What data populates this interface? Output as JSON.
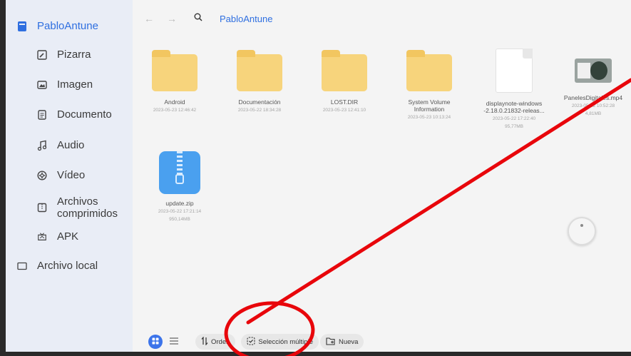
{
  "sidebar": {
    "root": {
      "label": "PabloAntune",
      "icon": "phone-icon"
    },
    "items": [
      {
        "label": "Pizarra",
        "icon": "whiteboard-icon"
      },
      {
        "label": "Imagen",
        "icon": "image-icon"
      },
      {
        "label": "Documento",
        "icon": "document-icon"
      },
      {
        "label": "Audio",
        "icon": "music-note-icon"
      },
      {
        "label": "Vídeo",
        "icon": "video-icon"
      },
      {
        "label": "Archivos",
        "label2": "comprimidos",
        "icon": "archive-icon"
      },
      {
        "label": "APK",
        "icon": "apk-icon"
      }
    ],
    "local": {
      "label": "Archivo local",
      "icon": "folder-outline-icon"
    }
  },
  "topbar": {
    "back": "←",
    "forward": "→",
    "path": "PabloAntune"
  },
  "files": [
    {
      "type": "folder",
      "name": "Android",
      "date": "2023-05-23  12:46:42"
    },
    {
      "type": "folder",
      "name": "Documentación",
      "date": "2023-05-22  18:34:28"
    },
    {
      "type": "folder",
      "name": "LOST.DIR",
      "date": "2023-05-23  12:41:10"
    },
    {
      "type": "folder",
      "name": "System Volume",
      "name2": "Information",
      "date": "2023-05-23  10:13:24"
    },
    {
      "type": "document",
      "name": "displaynote-windows",
      "name2": "-2.18.0.21832-releas...",
      "date": "2023-05-22  17:22:40",
      "size": "95,77MB"
    },
    {
      "type": "video",
      "name": "PanelesDigitales.mp4",
      "date": "2023-05-22  10:52:28",
      "size": "4,81MB"
    },
    {
      "type": "zip",
      "name": "update.zip",
      "date": "2023-05-22  17:21:14",
      "size": "950,14MB"
    }
  ],
  "toolbar": {
    "sort_label": "Orden",
    "multi_select_label": "Selección múltiple",
    "new_label": "Nueva"
  },
  "annotation_color": "#e8060b"
}
